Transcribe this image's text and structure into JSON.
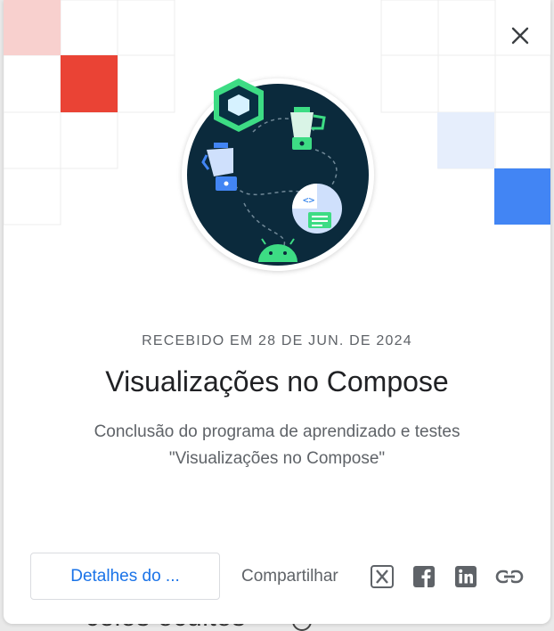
{
  "background": {
    "text": "celos ocultos"
  },
  "dialog": {
    "received": "RECEBIDO EM 28 DE JUN. DE 2024",
    "title": "Visualizações no Compose",
    "description_line1": "Conclusão do programa de aprendizado e testes",
    "description_line2": "\"Visualizações no Compose\"",
    "details_button": "Detalhes do ...",
    "share_label": "Compartilhar",
    "share_icons": [
      "x-icon",
      "facebook-icon",
      "linkedin-icon",
      "link-icon"
    ]
  },
  "colors": {
    "accent": "#1a73e8",
    "red": "#ea4335",
    "blue": "#4285f4",
    "badge_bg": "#0b2a3c",
    "android_green": "#3ddc84"
  }
}
